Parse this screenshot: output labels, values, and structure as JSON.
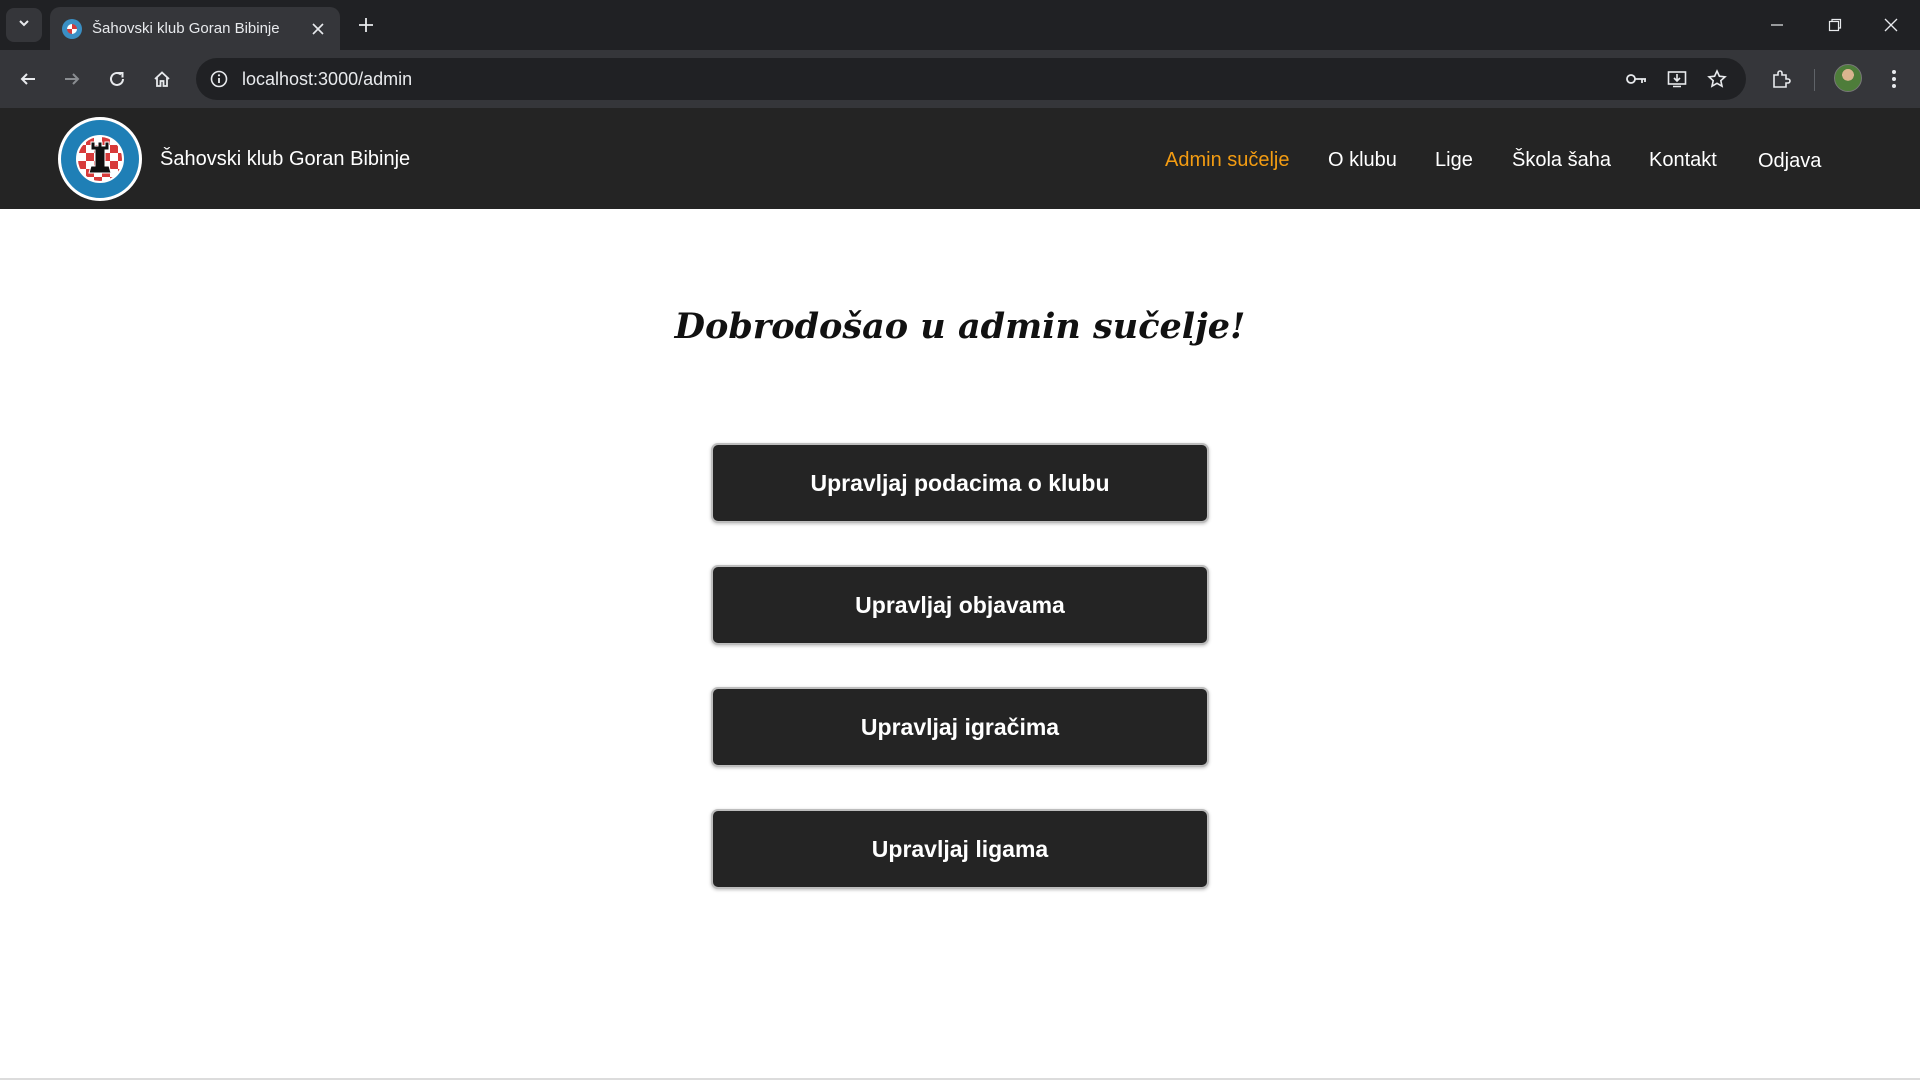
{
  "browser": {
    "tab_title": "Šahovski klub Goran Bibinje",
    "url": "localhost:3000/admin"
  },
  "site": {
    "title": "Šahovski klub Goran Bibinje",
    "nav": [
      {
        "label": "Admin sučelje",
        "active": true
      },
      {
        "label": "O klubu",
        "active": false
      },
      {
        "label": "Lige",
        "active": false
      },
      {
        "label": "Škola šaha",
        "active": false
      },
      {
        "label": "Kontakt",
        "active": false
      },
      {
        "label": "Odjava",
        "active": false
      }
    ],
    "accent_color": "#f39c12"
  },
  "main": {
    "heading": "Dobrodošao u admin sučelje!",
    "buttons": [
      "Upravljaj podacima o klubu",
      "Upravljaj objavama",
      "Upravljaj igračima",
      "Upravljaj ligama"
    ]
  }
}
